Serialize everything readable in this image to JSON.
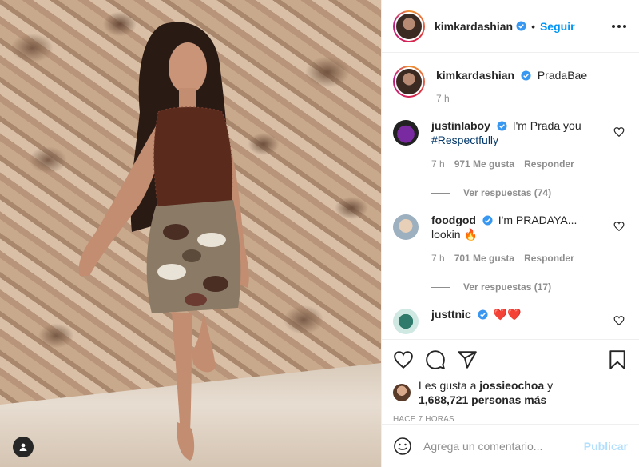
{
  "post_author": {
    "username": "kimkardashian",
    "verified": true,
    "follow_label": "Seguir"
  },
  "caption": {
    "username": "kimkardashian",
    "text": "PradaBae",
    "time": "7 h"
  },
  "comments": [
    {
      "username": "justinlaboy",
      "text": "I'm Prada you",
      "hashtag": "#Respectfully",
      "time": "7 h",
      "likes": "971 Me gusta",
      "reply_label": "Responder",
      "replies_label": "Ver respuestas (74)"
    },
    {
      "username": "foodgod",
      "text": "I'm PRADAYA...",
      "text2": "lookin",
      "emoji": "🔥",
      "time": "7 h",
      "likes": "701 Me gusta",
      "reply_label": "Responder",
      "replies_label": "Ver respuestas (17)"
    },
    {
      "username": "justtnic",
      "text": "❤️❤️"
    }
  ],
  "likes_summary": {
    "prefix": "Les gusta a",
    "user": "jossieochoa",
    "suffix": "y",
    "count_text": "1,688,721 personas más"
  },
  "timestamp": "HACE 7 HORAS",
  "add_comment": {
    "placeholder": "Agrega un comentario...",
    "publish_label": "Publicar"
  },
  "icons": {
    "like": "heart-icon",
    "comment": "comment-icon",
    "share": "paper-plane-icon",
    "save": "bookmark-icon",
    "emoji": "smiley-icon",
    "more": "more-options-icon",
    "tagged_user": "user-tag-icon"
  },
  "colors": {
    "accent": "#0095f6",
    "verified": "#3897f0",
    "publish_disabled": "#b2dffc"
  }
}
